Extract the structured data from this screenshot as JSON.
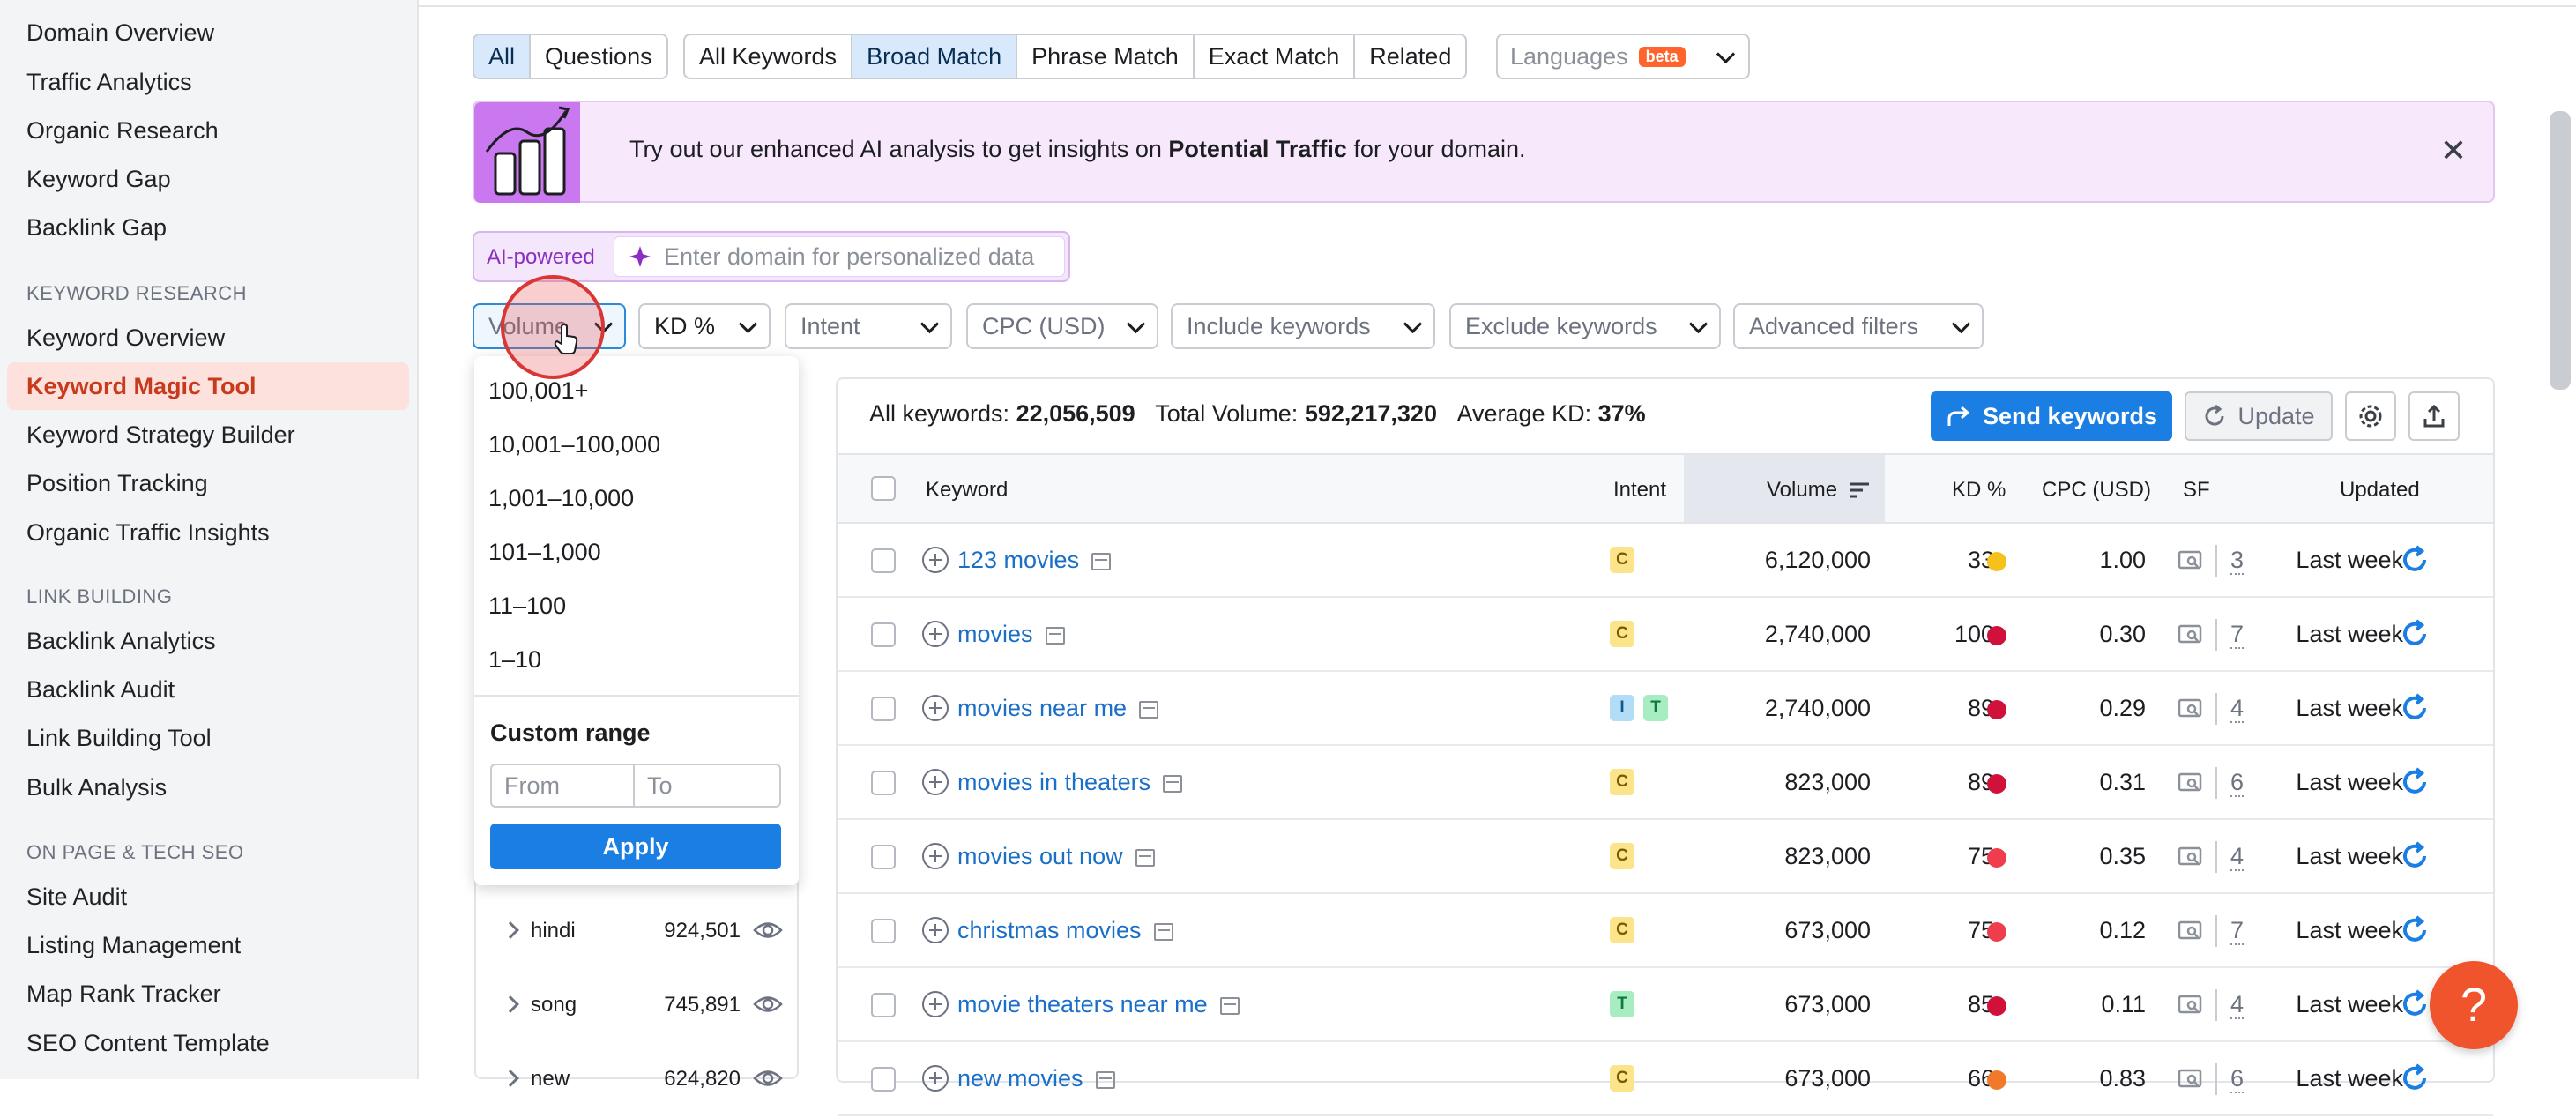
{
  "sidebar": {
    "items_top": [
      "Domain Overview",
      "Traffic Analytics",
      "Organic Research",
      "Keyword Gap",
      "Backlink Gap"
    ],
    "section_kr": "KEYWORD RESEARCH",
    "items_kr": [
      "Keyword Overview",
      "Keyword Magic Tool",
      "Keyword Strategy Builder",
      "Position Tracking",
      "Organic Traffic Insights"
    ],
    "section_lb": "LINK BUILDING",
    "items_lb": [
      "Backlink Analytics",
      "Backlink Audit",
      "Link Building Tool",
      "Bulk Analysis"
    ],
    "section_op": "ON PAGE & TECH SEO",
    "items_op": [
      "Site Audit",
      "Listing Management",
      "Map Rank Tracker",
      "SEO Content Template"
    ],
    "active": "Keyword Magic Tool"
  },
  "tabs": {
    "type": [
      "All",
      "Questions"
    ],
    "match": [
      "All Keywords",
      "Broad Match",
      "Phrase Match",
      "Exact Match",
      "Related"
    ],
    "selected_type": "All",
    "selected_match": "Broad Match",
    "languages": "Languages",
    "beta": "beta"
  },
  "banner": {
    "text_before": "Try out our enhanced AI analysis to get insights on ",
    "text_bold": "Potential Traffic",
    "text_after": " for your domain.",
    "close": "✕"
  },
  "ai": {
    "label": "AI-powered",
    "placeholder": "Enter domain for personalized data"
  },
  "filters": [
    "Volume",
    "KD %",
    "Intent",
    "CPC (USD)",
    "Include keywords",
    "Exclude keywords",
    "Advanced filters"
  ],
  "volume_dropdown": {
    "options": [
      "100,001+",
      "10,001–100,000",
      "1,001–10,000",
      "101–1,000",
      "11–100",
      "1–10"
    ],
    "custom_range": "Custom range",
    "from": "From",
    "to": "To",
    "apply": "Apply"
  },
  "groups": [
    {
      "name": "hindi",
      "count": "924,501"
    },
    {
      "name": "song",
      "count": "745,891"
    },
    {
      "name": "new",
      "count": "624,820"
    }
  ],
  "summary": {
    "all_label": "All keywords: ",
    "all_value": "22,056,509",
    "vol_label": "Total Volume: ",
    "vol_value": "592,217,320",
    "kd_label": "Average KD: ",
    "kd_value": "37%"
  },
  "buttons": {
    "send": "Send keywords",
    "update": "Update"
  },
  "table": {
    "headers": {
      "keyword": "Keyword",
      "intent": "Intent",
      "volume": "Volume",
      "kd": "KD %",
      "cpc": "CPC (USD)",
      "sf": "SF",
      "updated": "Updated"
    },
    "rows": [
      {
        "keyword": "123 movies",
        "intent": [
          "C"
        ],
        "volume": "6,120,000",
        "kd": "33",
        "kd_color": "#f5c11b",
        "cpc": "1.00",
        "sf": "3",
        "updated": "Last week"
      },
      {
        "keyword": "movies",
        "intent": [
          "C"
        ],
        "volume": "2,740,000",
        "kd": "100",
        "kd_color": "#d0123b",
        "cpc": "0.30",
        "sf": "7",
        "updated": "Last week"
      },
      {
        "keyword": "movies near me",
        "intent": [
          "I",
          "T"
        ],
        "volume": "2,740,000",
        "kd": "89",
        "kd_color": "#d0123b",
        "cpc": "0.29",
        "sf": "4",
        "updated": "Last week"
      },
      {
        "keyword": "movies in theaters",
        "intent": [
          "C"
        ],
        "volume": "823,000",
        "kd": "89",
        "kd_color": "#d0123b",
        "cpc": "0.31",
        "sf": "6",
        "updated": "Last week"
      },
      {
        "keyword": "movies out now",
        "intent": [
          "C"
        ],
        "volume": "823,000",
        "kd": "75",
        "kd_color": "#ef3d4d",
        "cpc": "0.35",
        "sf": "4",
        "updated": "Last week"
      },
      {
        "keyword": "christmas movies",
        "intent": [
          "C"
        ],
        "volume": "673,000",
        "kd": "75",
        "kd_color": "#ef3d4d",
        "cpc": "0.12",
        "sf": "7",
        "updated": "Last week"
      },
      {
        "keyword": "movie theaters near me",
        "intent": [
          "T"
        ],
        "volume": "673,000",
        "kd": "85",
        "kd_color": "#d0123b",
        "cpc": "0.11",
        "sf": "4",
        "updated": "Last week"
      },
      {
        "keyword": "new movies",
        "intent": [
          "C"
        ],
        "volume": "673,000",
        "kd": "66",
        "kd_color": "#f07a2a",
        "cpc": "0.83",
        "sf": "6",
        "updated": "Last week"
      }
    ]
  },
  "help": "?",
  "colors": {
    "accent": "#1a7ee3",
    "active_nav": "#c73a1c",
    "intent_c": "#fbe48a",
    "intent_i": "#b3dcf7",
    "intent_t": "#a8ecc2"
  }
}
